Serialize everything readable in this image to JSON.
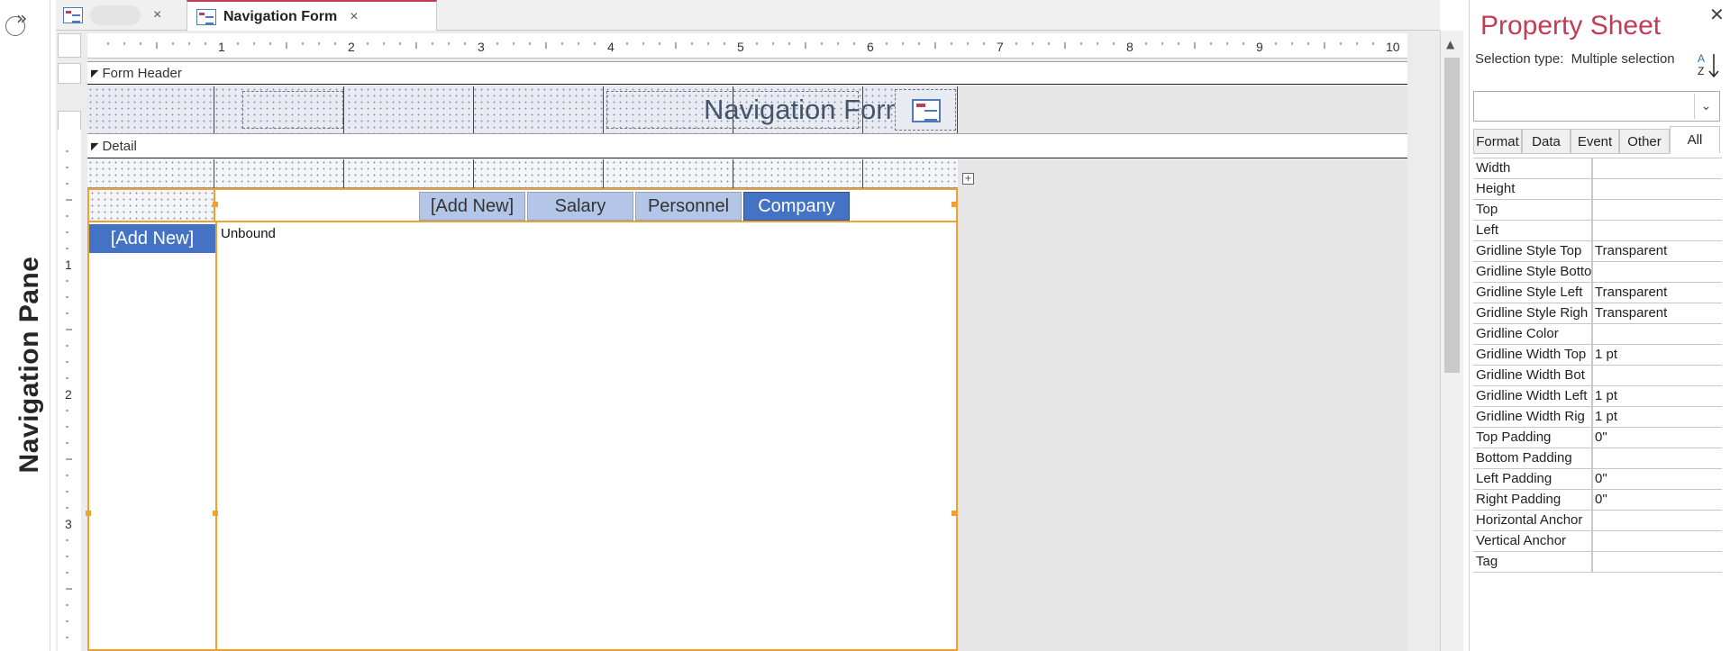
{
  "nav_pane": {
    "label": "Navigation Pane",
    "expand_icon": "double-chevron-right"
  },
  "tabs": [
    {
      "title": "",
      "close": "×",
      "icon": "form-icon"
    },
    {
      "title": "Navigation Form",
      "close": "×",
      "icon": "form-icon"
    }
  ],
  "ruler": {
    "h_numbers": [
      "1",
      "2",
      "3",
      "4",
      "5",
      "6",
      "7",
      "8",
      "9",
      "10"
    ],
    "v_numbers": [
      "1",
      "2",
      "3"
    ]
  },
  "sections": {
    "form_header": "Form Header",
    "detail": "Detail"
  },
  "form_header": {
    "title": "Navigation Form"
  },
  "nav_control": {
    "tabs": [
      "[Add New]",
      "Salary",
      "Personnel",
      "Company"
    ],
    "active_tab": "Company",
    "side_button": "[Add New]",
    "subform_label": "Unbound"
  },
  "property_sheet": {
    "title": "Property Sheet",
    "close": "✕",
    "selection_label": "Selection type:",
    "selection_value": "Multiple selection",
    "dropdown_value": "",
    "tabs": [
      "Format",
      "Data",
      "Event",
      "Other",
      "All"
    ],
    "active_tab": "All",
    "rows": [
      {
        "name": "Width",
        "value": ""
      },
      {
        "name": "Height",
        "value": ""
      },
      {
        "name": "Top",
        "value": ""
      },
      {
        "name": "Left",
        "value": ""
      },
      {
        "name": "Gridline Style Top",
        "value": "Transparent"
      },
      {
        "name": "Gridline Style Botto",
        "value": ""
      },
      {
        "name": "Gridline Style Left",
        "value": "Transparent"
      },
      {
        "name": "Gridline Style Righ",
        "value": "Transparent"
      },
      {
        "name": "Gridline Color",
        "value": ""
      },
      {
        "name": "Gridline Width Top",
        "value": "1 pt"
      },
      {
        "name": "Gridline Width Bot",
        "value": ""
      },
      {
        "name": "Gridline Width Left",
        "value": "1 pt"
      },
      {
        "name": "Gridline Width Rig",
        "value": "1 pt"
      },
      {
        "name": "Top Padding",
        "value": "0\""
      },
      {
        "name": "Bottom Padding",
        "value": ""
      },
      {
        "name": "Left Padding",
        "value": "0\""
      },
      {
        "name": "Right Padding",
        "value": "0\""
      },
      {
        "name": "Horizontal Anchor",
        "value": ""
      },
      {
        "name": "Vertical Anchor",
        "value": ""
      },
      {
        "name": "Tag",
        "value": ""
      }
    ]
  },
  "colors": {
    "accent": "#c23b57",
    "selection": "#f0a030",
    "active_tab": "#4472c4",
    "tab": "#b4c6e7"
  }
}
